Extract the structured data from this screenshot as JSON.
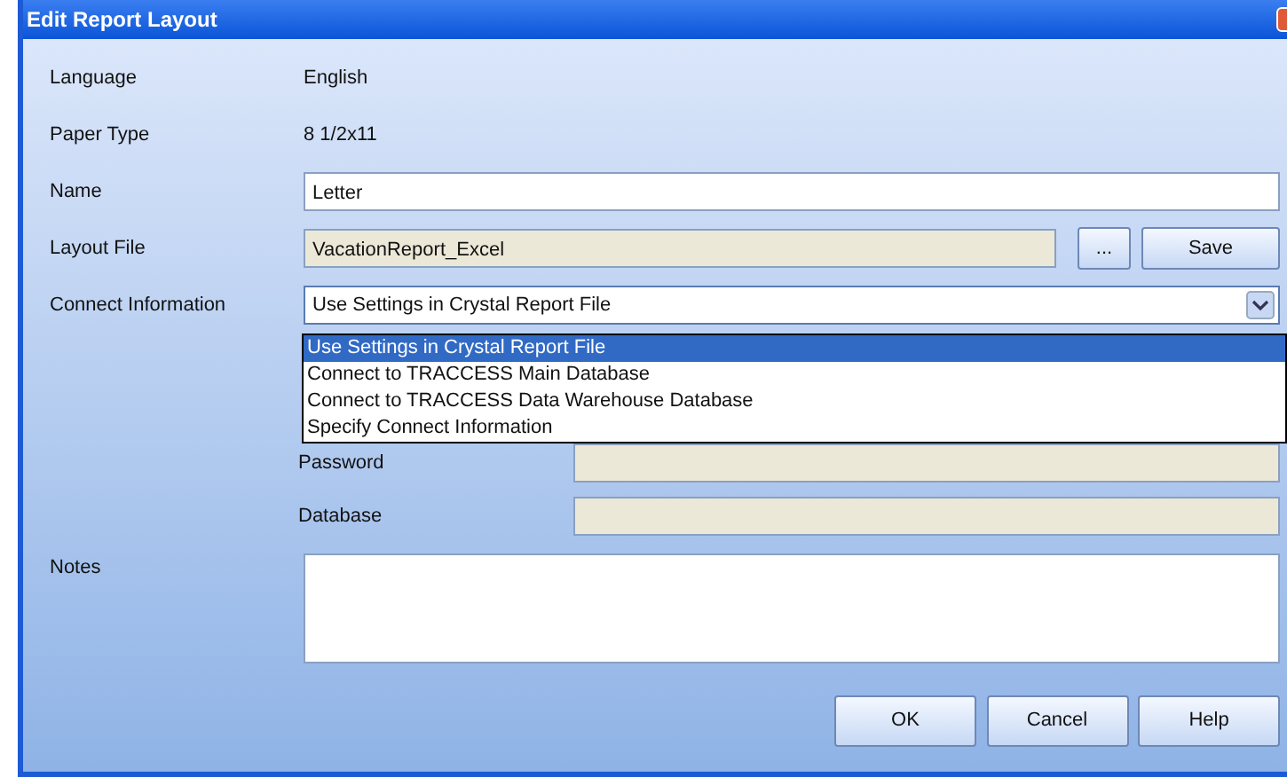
{
  "window": {
    "title": "Edit Report Layout"
  },
  "fields": [
    {
      "label": "Language",
      "value": "English",
      "kind": "text"
    },
    {
      "label": "Paper Type",
      "value": "8 1/2x11",
      "kind": "text"
    },
    {
      "label": "Name",
      "value": "Letter",
      "kind": "input"
    },
    {
      "label": "Layout File",
      "value": "VacationReport_Excel",
      "kind": "file"
    }
  ],
  "browse_button": "...",
  "save_button": "Save",
  "connect": {
    "label": "Connect Information",
    "value": "Use Settings in Crystal Report File",
    "expanded": true,
    "options": [
      {
        "label": "Use Settings in Crystal Report File",
        "selected": true
      },
      {
        "label": "Connect to TRACCESS Main Database",
        "selected": false
      },
      {
        "label": "Connect to TRACCESS Data Warehouse Database",
        "selected": false
      },
      {
        "label": "Specify Connect Information",
        "selected": false
      }
    ]
  },
  "sub_fields": [
    {
      "label": "Password"
    },
    {
      "label": "Database"
    }
  ],
  "notes": {
    "label": "Notes"
  },
  "buttons": [
    "OK",
    "Cancel",
    "Help"
  ]
}
